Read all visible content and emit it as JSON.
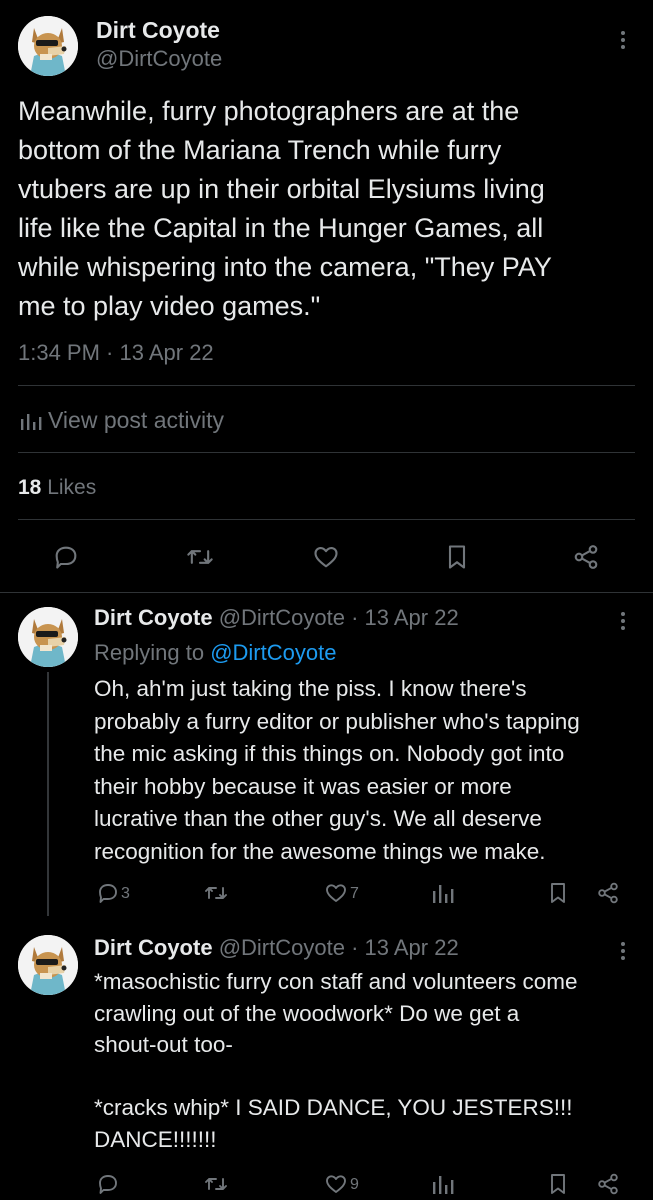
{
  "main_post": {
    "display_name": "Dirt Coyote",
    "handle": "@DirtCoyote",
    "text_lines": [
      "Meanwhile, furry photographers are at the",
      "bottom of the Mariana Trench while furry",
      "vtubers are up in their orbital Elysiums living",
      "life like the Capital in the Hunger Games, all",
      "while whispering into the camera, \"They PAY",
      "me to play video games.\""
    ],
    "timestamp": "1:34 PM · 13 Apr 22",
    "activity_label": "View post activity",
    "likes_count": "18",
    "likes_label": "Likes"
  },
  "replies": [
    {
      "display_name": "Dirt Coyote",
      "handle": "@DirtCoyote",
      "date": "· 13 Apr 22",
      "replying_prefix": "Replying to",
      "replying_handle": "@DirtCoyote",
      "text_lines": [
        "Oh, ah'm just taking the piss. I know there's",
        "probably a furry editor or publisher who's tapping",
        "the mic asking if this things on. Nobody got into",
        "their hobby because it was easier or more",
        "lucrative than the other guy's. We all deserve",
        "recognition for the awesome things we make."
      ],
      "reply_count": "3",
      "like_count": "7"
    },
    {
      "display_name": "Dirt Coyote",
      "handle": "@DirtCoyote",
      "date": "· 13 Apr 22",
      "text_lines": [
        "*masochistic furry con staff and volunteers come",
        "crawling out of the woodwork* Do we get a",
        "shout-out too-",
        "",
        "*cracks whip* I SAID DANCE, YOU JESTERS!!!",
        "DANCE!!!!!!!"
      ],
      "like_count": "9"
    }
  ],
  "colors": {
    "background": "#000000",
    "text": "#e7e9ea",
    "muted": "#71767b",
    "link": "#1d9bf0",
    "divider": "#2f3336"
  },
  "icons": [
    "more-icon",
    "reply-icon",
    "retweet-icon",
    "like-icon",
    "bookmark-icon",
    "share-icon",
    "views-icon"
  ]
}
